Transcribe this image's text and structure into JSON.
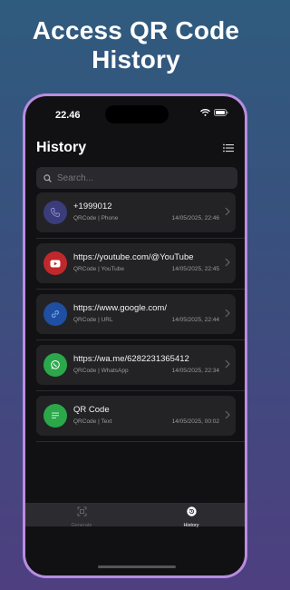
{
  "headline": {
    "line1": "Access QR Code",
    "line2": "History"
  },
  "status_bar": {
    "time": "22.46"
  },
  "header": {
    "title": "History"
  },
  "search": {
    "placeholder": "Search..."
  },
  "history": [
    {
      "value": "+1999012",
      "type": "QRCode | Phone",
      "date": "14/05/2025, 22:46",
      "icon": "phone-icon",
      "color": "#3b3d7a"
    },
    {
      "value": "https://youtube.com/@YouTube",
      "type": "QRCode | YouTube",
      "date": "14/05/2025, 22:45",
      "icon": "youtube-icon",
      "color": "#c0282b"
    },
    {
      "value": "https://www.google.com/",
      "type": "QRCode | URL",
      "date": "14/05/2025, 22:44",
      "icon": "link-icon",
      "color": "#1f4fa0"
    },
    {
      "value": "https://wa.me/6282231365412",
      "type": "QRCode | WhatsApp",
      "date": "14/05/2025, 22:34",
      "icon": "whatsapp-icon",
      "color": "#2aa84a"
    },
    {
      "value": "QR Code",
      "type": "QRCode | Text",
      "date": "14/05/2025, 00:02",
      "icon": "text-icon",
      "color": "#2aa84a"
    }
  ],
  "tabbar": {
    "generate": "Generate",
    "history": "History"
  }
}
